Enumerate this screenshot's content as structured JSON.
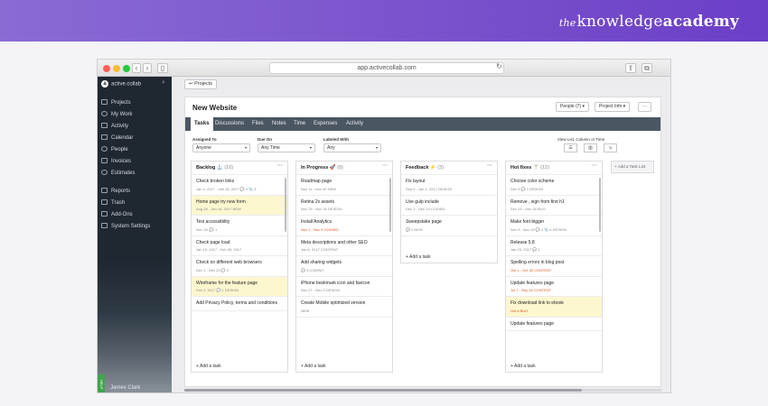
{
  "brand": {
    "prefix": "the",
    "name": "knowledge",
    "bold": "academy"
  },
  "browser": {
    "url": "app.activecollab.com",
    "back": "‹",
    "forward": "›"
  },
  "sidebar": {
    "account": "active.collab",
    "items": [
      {
        "label": "Projects"
      },
      {
        "label": "My Work"
      },
      {
        "label": "Activity"
      },
      {
        "label": "Calendar"
      },
      {
        "label": "People"
      },
      {
        "label": "Invoices"
      },
      {
        "label": "Estimates"
      },
      {
        "label": "Reports"
      },
      {
        "label": "Trash"
      },
      {
        "label": "Add-Ons"
      },
      {
        "label": "System Settings"
      }
    ],
    "user": "James Clark",
    "help": "HELP"
  },
  "breadcrumb": "↩ Projects",
  "project": {
    "title": "New Website",
    "people_button": "People (7) ▾",
    "project_info_button": "Project Info ▾",
    "more_button": "···",
    "tabs": [
      "Tasks",
      "Discussions",
      "Files",
      "Notes",
      "Time",
      "Expenses",
      "Activity"
    ]
  },
  "filters": {
    "assigned_label": "Assigned To",
    "assigned_value": "Anyone",
    "due_label": "Due On",
    "due_value": "Any Time",
    "labeled_label": "Labeled With",
    "labeled_value": "Any",
    "view_label": "View List, Column or Time"
  },
  "board": {
    "add_list": "+ Add a Task List",
    "columns": [
      {
        "name": "Backlog ⚓",
        "count": "(10)",
        "add": "+ Add a task",
        "tasks": [
          {
            "title": "Check broken links",
            "meta": "Jan 4, 2017 - Jan 18, 2017  💬 3  📎 8"
          },
          {
            "title": "Home page try new form",
            "meta": "Aug 28 - Jan 18, 2017  NEW",
            "hl": true
          },
          {
            "title": "Test accessibility",
            "meta": "Nov 28,  💬 1"
          },
          {
            "title": "Check page load",
            "meta": "Jan 15, 2017 - Feb 28, 2017"
          },
          {
            "title": "Check on different web browsers",
            "meta": "Dec 2 - Dec 20  💬 2"
          },
          {
            "title": "Wireframe for the feature page",
            "meta": "Feb 3, 2017  💬 1  DESIGN",
            "hl": true
          },
          {
            "title": "Add Privacy Policy, terms and conditions",
            "meta": ""
          }
        ]
      },
      {
        "name": "In Progress 🚀",
        "count": "(8)",
        "add": "+ Add a task",
        "tasks": [
          {
            "title": "Roadmap page",
            "meta": "Nov 11 - Nov 30  NEW"
          },
          {
            "title": "Retina 2x assets",
            "meta": "Nov 25 - Nov 30  DESIGN"
          },
          {
            "title": "Install Analytics",
            "meta": "Nov 1 - Nov 9  CODING",
            "late": true
          },
          {
            "title": "Meta descriptions and other SEO",
            "meta": "Jan 6, 2017  CONTENT"
          },
          {
            "title": "Add sharing widgets",
            "meta": "💬 3  CODING"
          },
          {
            "title": "iPhone bookmark icon and favicon",
            "meta": "Nov 27 - Dec 9  DESIGN"
          },
          {
            "title": "Create Mobile optimized version",
            "meta": "NEW"
          }
        ]
      },
      {
        "name": "Feedback ⚡",
        "count": "(3)",
        "add": "+ Add a task",
        "tasks": [
          {
            "title": "Fix layout",
            "meta": "Sep 6 - Jan 1, 2017  DESIGN"
          },
          {
            "title": "Use gulp include",
            "meta": "Dec 3 - Dec 19  CODING"
          },
          {
            "title": "Sweepstake page",
            "meta": "💬 2  NEW"
          }
        ]
      },
      {
        "name": "Hot fixes 🍸",
        "count": "(12)",
        "add": "+ Add a task",
        "tasks": [
          {
            "title": "Choose color scheme",
            "meta": "Dec 6  💬 7  DESIGN"
          },
          {
            "title": "Remove , sign from first h1",
            "meta": "Dec 25 - Dec 30  BUG"
          },
          {
            "title": "Make font bigger",
            "meta": "Nov 5 - Nov 22  💬 1  📎 6  DESIGN"
          },
          {
            "title": "Release 5.8",
            "meta": "Jan 23, 2017  💬 1"
          },
          {
            "title": "Spelling errors in blog post",
            "meta": "Oct 1 - Oct 30  CONTENT",
            "late": true
          },
          {
            "title": "Update features page",
            "meta": "Jul 7 - Sep 26  CONTENT",
            "late": true
          },
          {
            "title": "Fix download link to ebook",
            "meta": "Oct 6  BUG",
            "late": true,
            "hl": true
          },
          {
            "title": "Update features page",
            "meta": ""
          }
        ]
      }
    ]
  }
}
